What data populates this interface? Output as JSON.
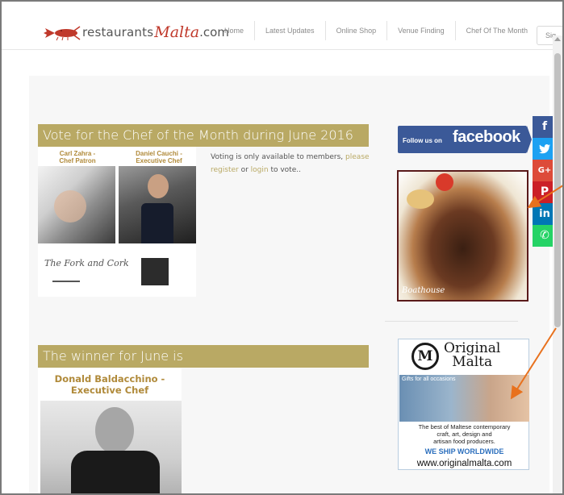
{
  "header": {
    "logo": {
      "icon": "lobster-icon",
      "text_prefix": "restaurants",
      "text_script": "Malta",
      "text_suffix": ".com"
    },
    "nav": [
      {
        "label": "Home"
      },
      {
        "label": "Latest Updates"
      },
      {
        "label": "Online Shop"
      },
      {
        "label": "Venue Finding"
      },
      {
        "label": "Chef Of The Month"
      }
    ],
    "signin_label": "Sig"
  },
  "vote_section": {
    "banner": "Vote for the Chef of the Month during June 2016",
    "image": {
      "caption_left": "Carl Zahra -\nChef Patron",
      "caption_right": "Daniel Cauchi -\nExecutive Chef",
      "restaurant_name": "The Fork and Cork"
    },
    "text_before": "Voting is only available to members, ",
    "link_please_register": "please register",
    "text_or": " or ",
    "link_login": "login",
    "text_after": " to vote.."
  },
  "winner_section": {
    "banner": "The winner for June is",
    "caption_line1": "Donald Baldacchino -",
    "caption_line2": "Executive Chef"
  },
  "sidebar": {
    "facebook": {
      "small": "Follow us on",
      "big": "facebook"
    },
    "steak_ad": {
      "brand": "Boathouse"
    },
    "original_malta_ad": {
      "logo_letter": "M",
      "title_line1": "Original",
      "title_line2": "Malta",
      "tagline": "Gifts for all occasions",
      "desc_line1": "The best of Maltese contemporary",
      "desc_line2": "craft, art, design and",
      "desc_line3": "artisan food producers.",
      "ship": "WE SHIP WORLDWIDE",
      "url": "www.originalmalta.com"
    }
  },
  "share_bar": [
    {
      "network": "facebook",
      "glyph": "f",
      "icon": "facebook-icon"
    },
    {
      "network": "twitter",
      "glyph": "🐦",
      "icon": "twitter-icon"
    },
    {
      "network": "google-plus",
      "glyph": "G+",
      "icon": "google-plus-icon"
    },
    {
      "network": "pinterest",
      "glyph": "P",
      "icon": "pinterest-icon"
    },
    {
      "network": "linkedin",
      "glyph": "in",
      "icon": "linkedin-icon"
    },
    {
      "network": "whatsapp",
      "glyph": "✆",
      "icon": "whatsapp-icon"
    }
  ],
  "colors": {
    "banner": "#b9a964",
    "link": "#b9a964",
    "caption": "#b08a3a",
    "facebook": "#3b5998",
    "annotation_arrow": "#e8711d"
  }
}
